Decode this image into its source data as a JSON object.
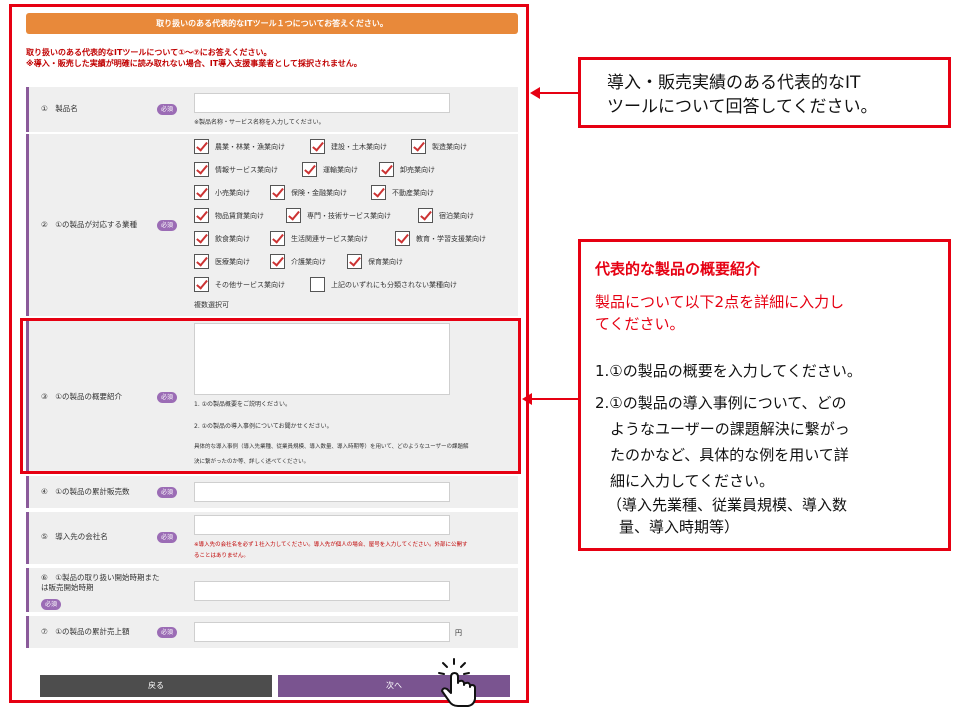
{
  "header": {
    "title": "取り扱いのある代表的なITツール１つについてお答えください。"
  },
  "intro": {
    "line1": "取り扱いのある代表的なITツールについて①〜⑦にお答えください。",
    "line2": "※導入・販売した実績が明確に読み取れない場合、IT導入支援事業者として採択されません。"
  },
  "required_badge": "必須",
  "q1": {
    "label": "①　製品名",
    "note": "※製品名称・サービス名称を入力してください。"
  },
  "q2": {
    "label": "②　①の製品が対応する業種",
    "options": [
      {
        "label": "農業・林業・漁業向け",
        "checked": true
      },
      {
        "label": "建設・土木業向け",
        "checked": true
      },
      {
        "label": "製造業向け",
        "checked": true
      },
      {
        "label": "情報サービス業向け",
        "checked": true
      },
      {
        "label": "運輸業向け",
        "checked": true
      },
      {
        "label": "卸売業向け",
        "checked": true
      },
      {
        "label": "小売業向け",
        "checked": true
      },
      {
        "label": "保険・金融業向け",
        "checked": true
      },
      {
        "label": "不動産業向け",
        "checked": true
      },
      {
        "label": "物品賃貸業向け",
        "checked": true
      },
      {
        "label": "専門・技術サービス業向け",
        "checked": true
      },
      {
        "label": "宿泊業向け",
        "checked": true
      },
      {
        "label": "飲食業向け",
        "checked": true
      },
      {
        "label": "生活関連サービス業向け",
        "checked": true
      },
      {
        "label": "教育・学習支援業向け",
        "checked": true
      },
      {
        "label": "医療業向け",
        "checked": true
      },
      {
        "label": "介護業向け",
        "checked": true
      },
      {
        "label": "保育業向け",
        "checked": true
      },
      {
        "label": "その他サービス業向け",
        "checked": true
      },
      {
        "label": "上記のいずれにも分類されない業種向け",
        "checked": false
      }
    ],
    "note": "複数選択可"
  },
  "q3": {
    "label": "③　①の製品の概要紹介",
    "notes": [
      "1. ①の製品概要をご説明ください。",
      "2. ①の製品の導入事例についてお聞かせください。",
      "具体的な導入事例（導入先業種、従業員規模、導入数量、導入時期等）を用いて、どのようなユーザーの課題解",
      "決に繋がったのか等、詳しく述べてください。"
    ]
  },
  "q4": {
    "label": "④　①の製品の累計販売数"
  },
  "q5": {
    "label": "⑤　導入先の会社名",
    "note1": "※導入先の会社名を必ず１社入力してください。導入先が個人の場合、屋号を入力してください。外部に公開す",
    "note2": "ることはありません。"
  },
  "q6": {
    "label1": "⑥　①製品の取り扱い開始時期また",
    "label2": "は販売開始時期"
  },
  "q7": {
    "label": "⑦　①の製品の累計売上額",
    "unit": "円"
  },
  "buttons": {
    "back": "戻る",
    "next": "次へ"
  },
  "callout1": {
    "line1": "導入・販売実績のある代表的なIT",
    "line2": "ツールについて回答してください。"
  },
  "callout2": {
    "title": "代表的な製品の概要紹介",
    "sub1": "製品について以下2点を詳細に入力し",
    "sub2": "てください。",
    "item1": "1.①の製品の概要を入力してください。",
    "item2_1": "2.①の製品の導入事例について、どの",
    "item2_2": "ようなユーザーの課題解決に繋がっ",
    "item2_3": "たのかなど、具体的な例を用いて詳",
    "item2_4": "細に入力してください。",
    "item2_5": "（導入先業種、従業員規模、導入数",
    "item2_6": "量、導入時期等）"
  }
}
